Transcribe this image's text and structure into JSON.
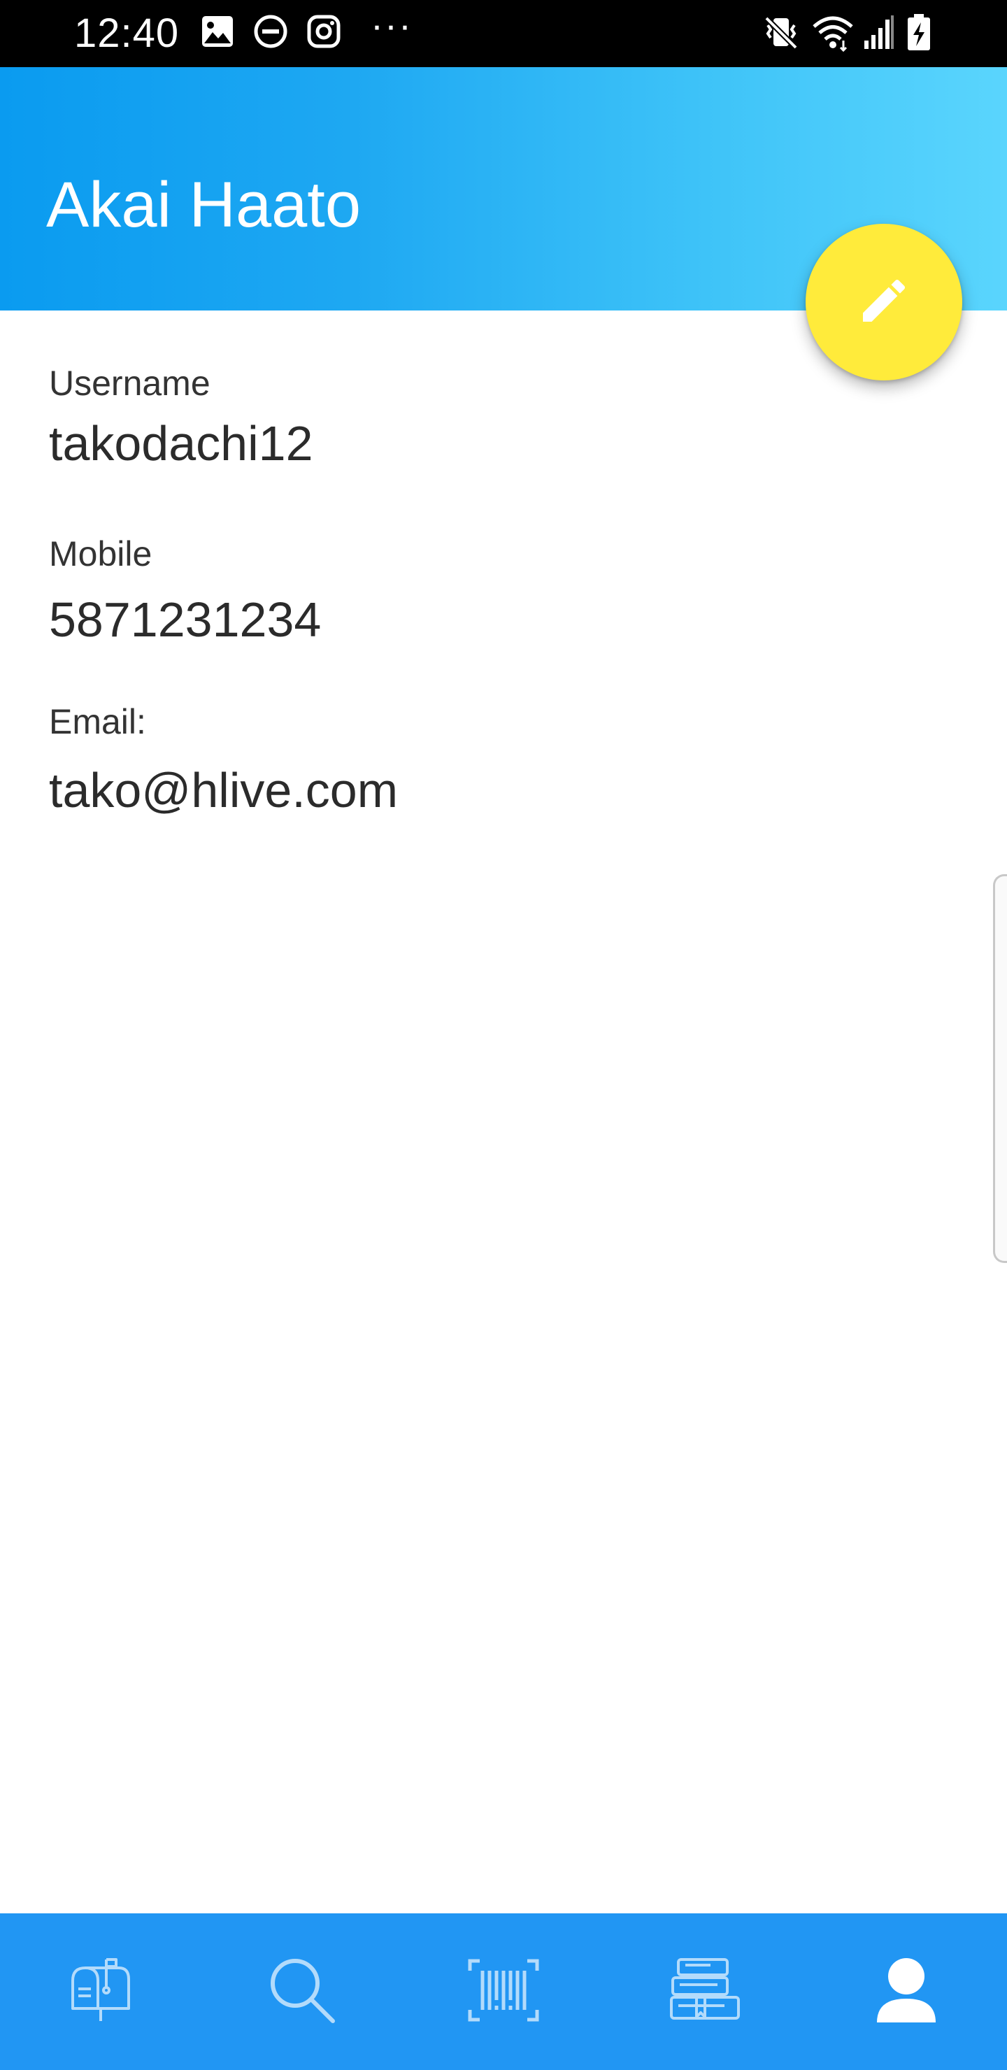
{
  "status_bar": {
    "time": "12:40",
    "more": "···",
    "left_icons": [
      "image-icon",
      "do-not-disturb-icon",
      "instagram-icon"
    ],
    "right_icons": [
      "vibrate-mute-icon",
      "wifi-icon",
      "cell-signal-icon",
      "battery-charging-icon"
    ]
  },
  "header": {
    "name": "Akai Haato",
    "gradient_colors": [
      "#0a9bf0",
      "#5ad5fd"
    ]
  },
  "fab": {
    "icon": "edit-pencil-icon",
    "color": "#ffeb3b"
  },
  "profile": {
    "username_label": "Username",
    "username_value": "takodachi12",
    "mobile_label": "Mobile",
    "mobile_value": "5871231234",
    "email_label": "Email:",
    "email_value": "tako@hlive.com"
  },
  "bottom_nav": {
    "color": "#2196f3",
    "items": [
      {
        "icon": "mailbox-icon",
        "active": false
      },
      {
        "icon": "search-icon",
        "active": false
      },
      {
        "icon": "barcode-scan-icon",
        "active": false
      },
      {
        "icon": "books-icon",
        "active": false
      },
      {
        "icon": "profile-icon",
        "active": true
      }
    ]
  }
}
